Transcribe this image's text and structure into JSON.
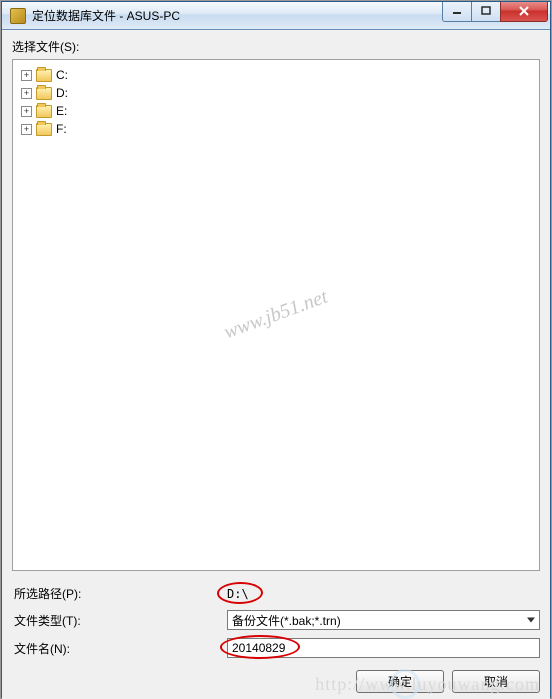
{
  "window": {
    "title": "定位数据库文件 - ASUS-PC"
  },
  "labels": {
    "select_files": "选择文件(S):",
    "selected_path": "所选路径(P):",
    "file_type": "文件类型(T):",
    "file_name": "文件名(N):"
  },
  "tree": {
    "drives": [
      {
        "label": "C:"
      },
      {
        "label": "D:"
      },
      {
        "label": "E:"
      },
      {
        "label": "F:"
      }
    ]
  },
  "form": {
    "selected_path_value": "D:\\",
    "file_type_value": "备份文件(*.bak;*.trn)",
    "file_name_value": "20140829"
  },
  "buttons": {
    "ok": "确定",
    "cancel": "取消"
  },
  "watermarks": {
    "center": "www.jb51.net",
    "bottom": "http://www.luyouwang.com"
  }
}
